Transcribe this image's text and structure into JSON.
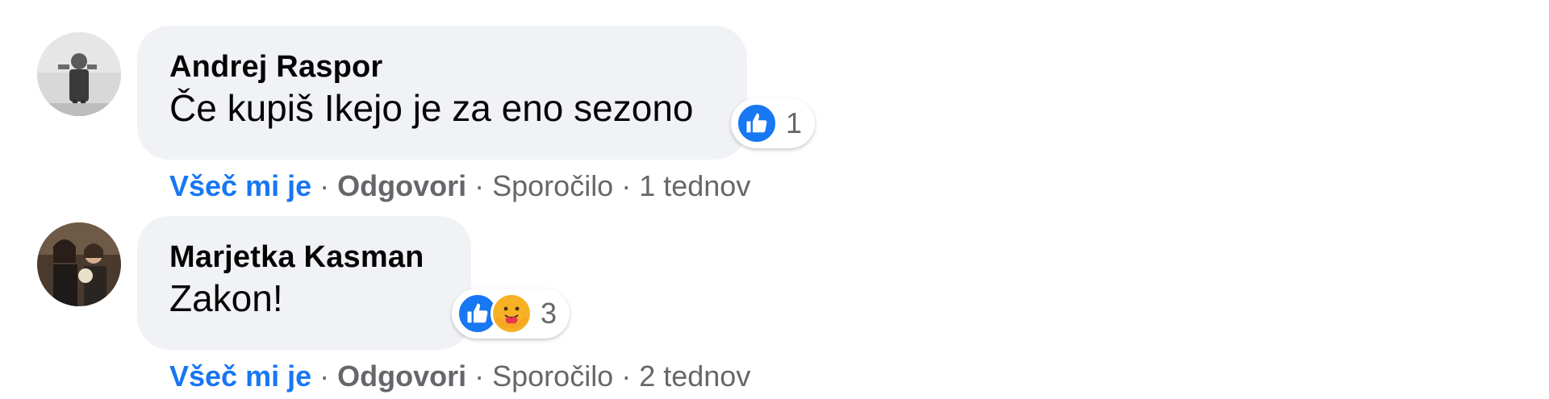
{
  "comments": [
    {
      "author": "Andrej Raspor",
      "text": "Če kupiš Ikejo je za eno sezono",
      "reactions": {
        "icons": [
          "like-icon"
        ],
        "count": "1"
      },
      "actions": {
        "like": "Všeč mi je",
        "reply": "Odgovori",
        "message": "Sporočilo",
        "time": "1 tednov"
      }
    },
    {
      "author": "Marjetka Kasman",
      "text": "Zakon!",
      "reactions": {
        "icons": [
          "like-icon",
          "care-icon"
        ],
        "count": "3"
      },
      "actions": {
        "like": "Všeč mi je",
        "reply": "Odgovori",
        "message": "Sporočilo",
        "time": "2 tednov"
      }
    }
  ],
  "separator": "·",
  "colors": {
    "bubble": "#f0f2f5",
    "link_blue": "#1877f2",
    "secondary_text": "#65676b",
    "primary_text": "#050505",
    "care_yellow": "#f7b125"
  }
}
